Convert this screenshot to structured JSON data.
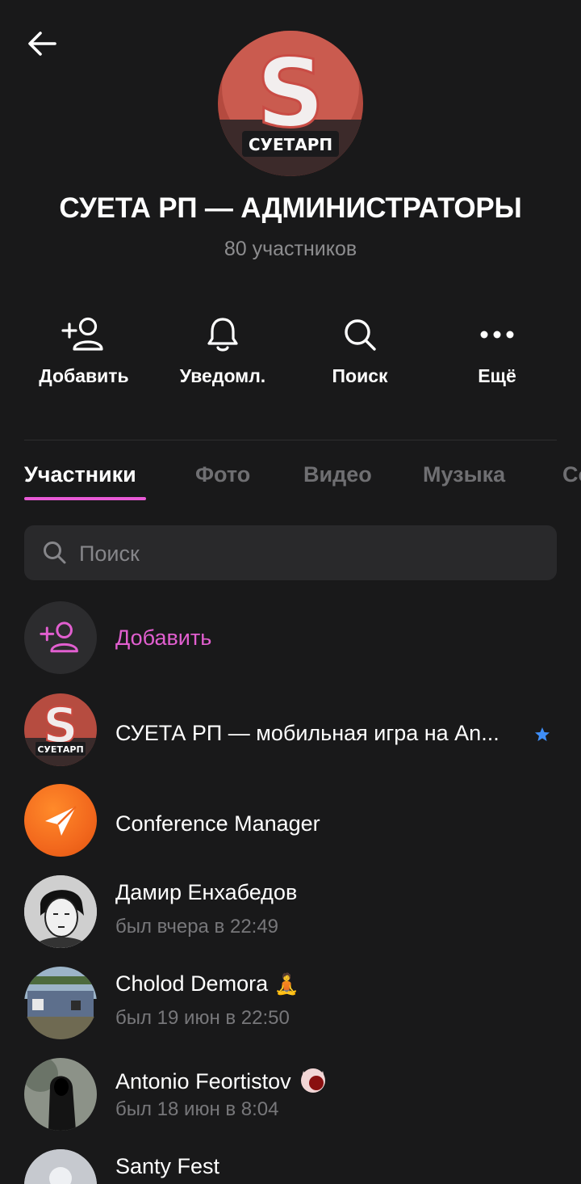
{
  "header": {
    "title": "СУЕТА РП — АДМИНИСТРАТОРЫ",
    "subtitle": "80 участников",
    "avatar_text": "СУЕТАРП"
  },
  "actions": [
    {
      "label": "Добавить",
      "icon": "add-user-icon"
    },
    {
      "label": "Уведомл.",
      "icon": "bell-icon"
    },
    {
      "label": "Поиск",
      "icon": "search-icon"
    },
    {
      "label": "Ещё",
      "icon": "more-icon"
    }
  ],
  "tabs": [
    {
      "label": "Участники",
      "active": true
    },
    {
      "label": "Фото"
    },
    {
      "label": "Видео"
    },
    {
      "label": "Музыка"
    },
    {
      "label": "Co"
    }
  ],
  "search": {
    "placeholder": "Поиск"
  },
  "add_row": {
    "label": "Добавить"
  },
  "members": [
    {
      "name": "СУЕТА РП — мобильная игра на An...",
      "status": "",
      "avatar_text": "СУЕТАРП",
      "badge": "star-icon"
    },
    {
      "name": "Conference Manager",
      "status": ""
    },
    {
      "name": "Дамир Енхабедов",
      "status": "был вчера в 22:49"
    },
    {
      "name": "Cholod Demora",
      "emoji": "🧘",
      "status": "был 19 июн в 22:50"
    },
    {
      "name": "Antonio Feortistov",
      "status": "был 18 июн в 8:04"
    },
    {
      "name": "Santy Fest",
      "status": ""
    }
  ],
  "colors": {
    "accent": "#e85ad6",
    "background": "#19191a",
    "star": "#3f8ef7",
    "conference": "#f2681d"
  }
}
